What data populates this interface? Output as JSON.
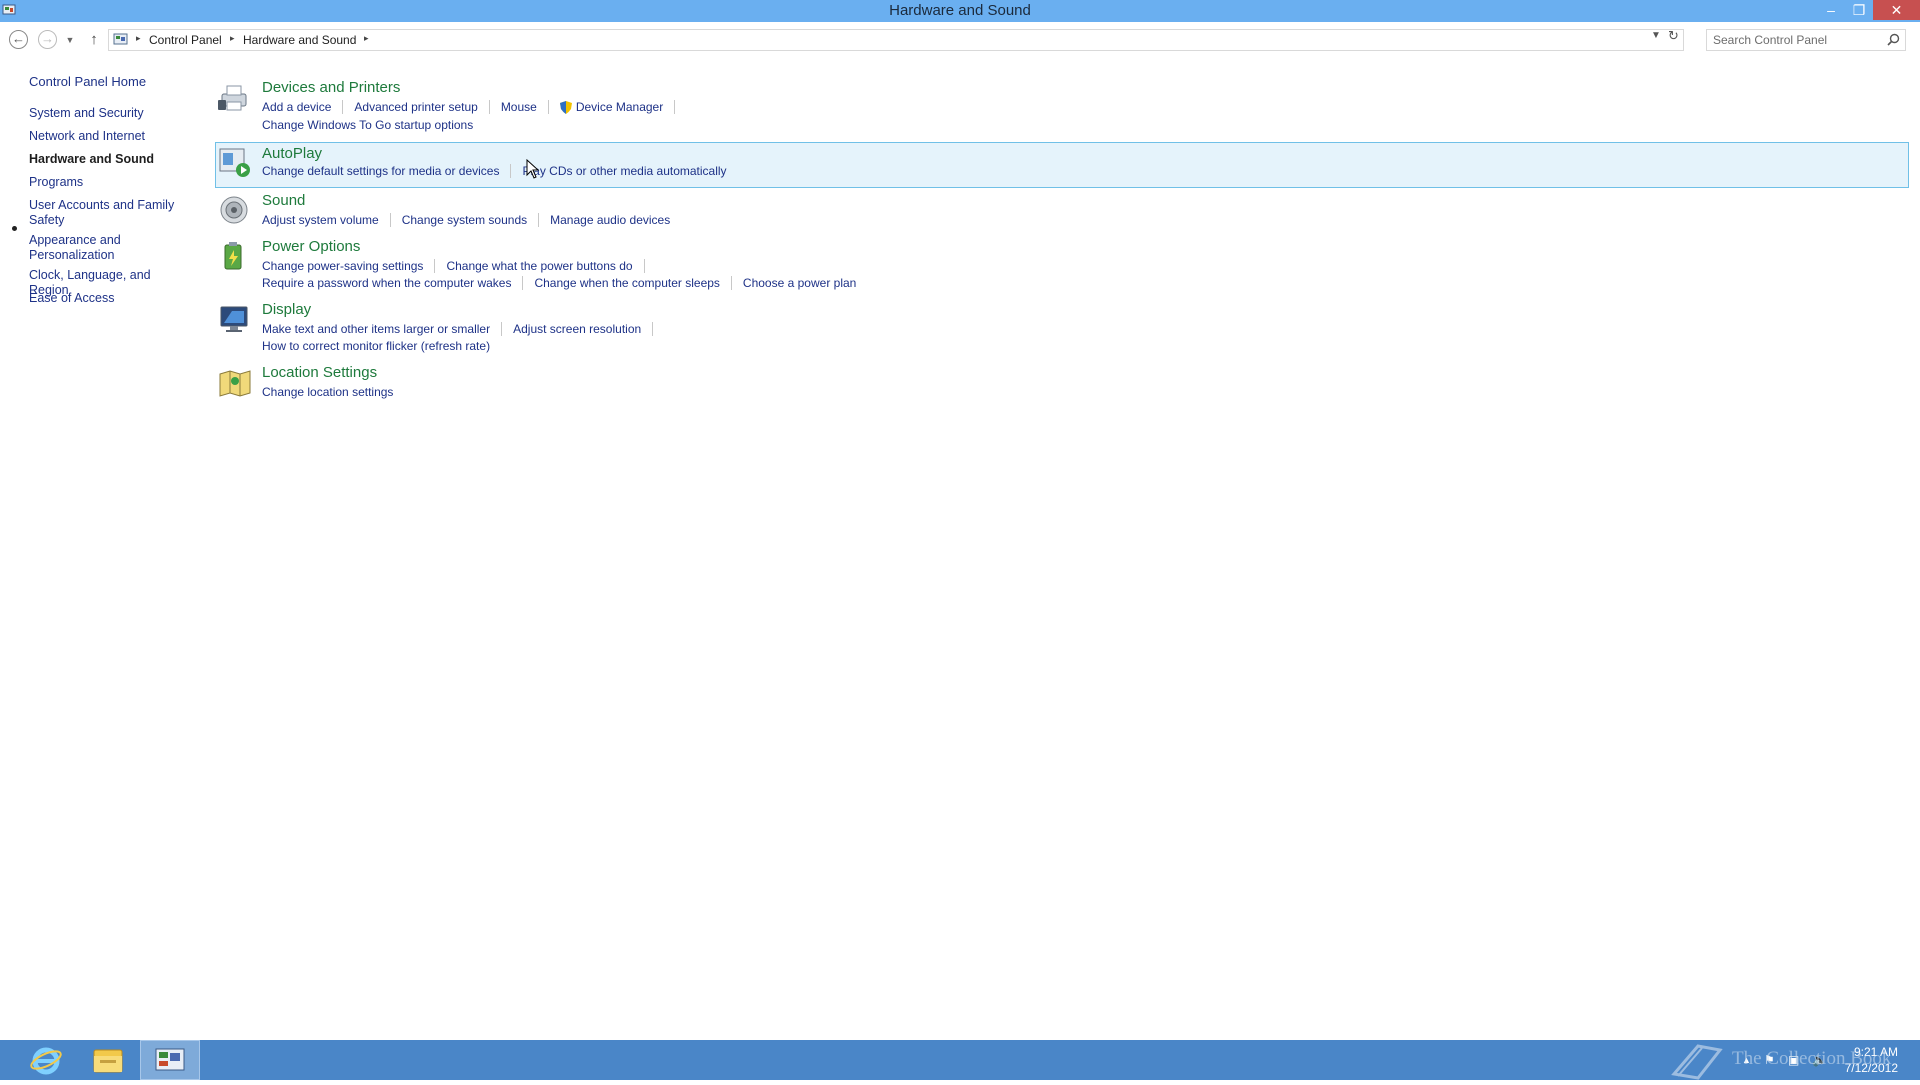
{
  "window": {
    "title": "Hardware and Sound",
    "controls": {
      "minimize": "–",
      "maximize": "❐",
      "close": "✕"
    }
  },
  "address": {
    "crumbs": [
      "Control Panel",
      "Hardware and Sound"
    ],
    "search_placeholder": "Search Control Panel"
  },
  "sidebar": {
    "home": "Control Panel Home",
    "items": [
      {
        "label": "System and Security"
      },
      {
        "label": "Network and Internet"
      },
      {
        "label": "Hardware and Sound",
        "active": true
      },
      {
        "label": "Programs"
      },
      {
        "label": "User Accounts and Family Safety"
      },
      {
        "label": "Appearance and Personalization"
      },
      {
        "label": "Clock, Language, and Region"
      },
      {
        "label": "Ease of Access"
      }
    ]
  },
  "categories": [
    {
      "title": "Devices and Printers",
      "icon": "printer-icon",
      "rows": [
        [
          "Add a device",
          "Advanced printer setup",
          "Mouse",
          "Device Manager"
        ],
        [
          "Change Windows To Go startup options"
        ]
      ]
    },
    {
      "title": "AutoPlay",
      "icon": "autoplay-icon",
      "rows": [
        [
          "Change default settings for media or devices",
          "Play CDs or other media automatically"
        ]
      ]
    },
    {
      "title": "Sound",
      "icon": "speaker-icon",
      "rows": [
        [
          "Adjust system volume",
          "Change system sounds",
          "Manage audio devices"
        ]
      ]
    },
    {
      "title": "Power Options",
      "icon": "battery-icon",
      "rows": [
        [
          "Change power-saving settings",
          "Change what the power buttons do"
        ],
        [
          "Require a password when the computer wakes",
          "Change when the computer sleeps",
          "Choose a power plan"
        ]
      ]
    },
    {
      "title": "Display",
      "icon": "monitor-icon",
      "rows": [
        [
          "Make text and other items larger or smaller",
          "Adjust screen resolution"
        ],
        [
          "How to correct monitor flicker (refresh rate)"
        ]
      ]
    },
    {
      "title": "Location Settings",
      "icon": "map-icon",
      "rows": [
        [
          "Change location settings"
        ]
      ]
    }
  ],
  "taskbar": {
    "clock_time": "9:21 AM",
    "clock_date": "7/12/2012",
    "watermark": "The Collection Book"
  },
  "colors": {
    "titlebar": "#6aaff0",
    "taskbar": "#4a86c8",
    "link": "#1e3287",
    "category_title": "#1e7a3c",
    "hover_bg": "#e5f3fb",
    "hover_border": "#70c0e7"
  }
}
